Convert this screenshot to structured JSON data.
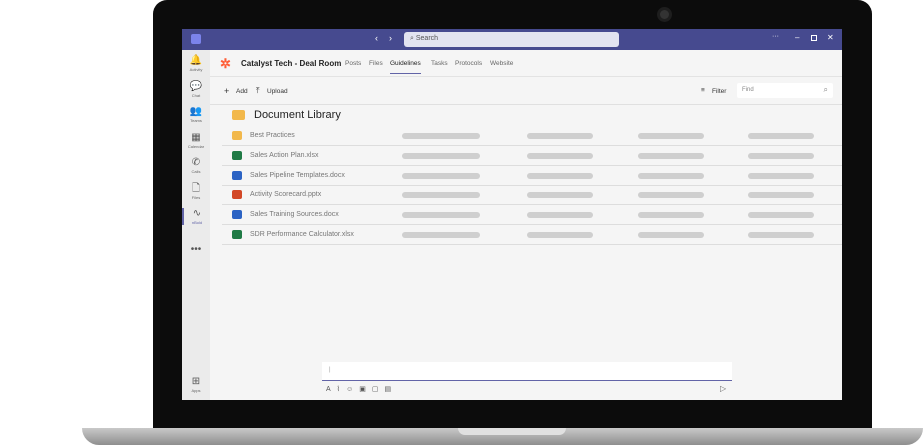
{
  "app": {
    "search_placeholder": "Search"
  },
  "rail": [
    {
      "label": "Activity",
      "icon": "bell-icon",
      "g": "🔔"
    },
    {
      "label": "Chat",
      "icon": "chat-icon",
      "g": "💬"
    },
    {
      "label": "Teams",
      "icon": "teams-icon",
      "g": "👥"
    },
    {
      "label": "Calendar",
      "icon": "calendar-icon",
      "g": "▦"
    },
    {
      "label": "Calls",
      "icon": "phone-icon",
      "g": "✆"
    },
    {
      "label": "Files",
      "icon": "file-icon",
      "g": "🗋"
    },
    {
      "label": "nBold",
      "icon": "nbold-icon",
      "g": "∿"
    }
  ],
  "rail_more": "•••",
  "rail_apps": "Apps",
  "channel": {
    "name": "Catalyst Tech - Deal Room",
    "tabs": [
      "Posts",
      "Files",
      "Guidelines",
      "Tasks",
      "Protocols",
      "Website"
    ],
    "active_tab": "Guidelines"
  },
  "toolbar": {
    "add": "Add",
    "upload": "Upload",
    "filter": "Filter",
    "find_placeholder": "Find"
  },
  "library": {
    "title": "Document Library",
    "items": [
      {
        "name": "Best Practices",
        "type": "folder",
        "color": "#f2b84b"
      },
      {
        "name": "Sales Action Plan.xlsx",
        "type": "excel",
        "color": "#1f7a45"
      },
      {
        "name": "Sales Pipeline Templates.docx",
        "type": "word",
        "color": "#2b63c4"
      },
      {
        "name": "Activity Scorecard.pptx",
        "type": "powerpoint",
        "color": "#d24726"
      },
      {
        "name": "Sales Training Sources.docx",
        "type": "word",
        "color": "#2b63c4"
      },
      {
        "name": "SDR Performance Calculator.xlsx",
        "type": "excel",
        "color": "#1f7a45"
      }
    ]
  },
  "compose": {
    "value": "|"
  }
}
